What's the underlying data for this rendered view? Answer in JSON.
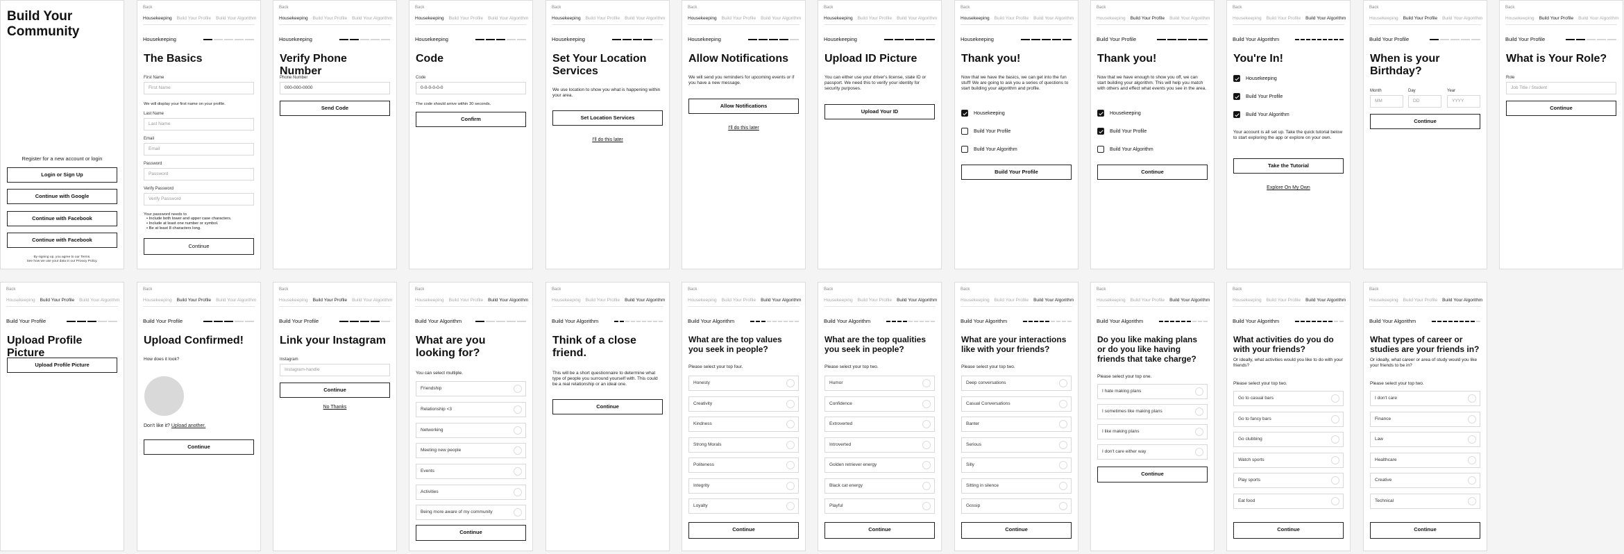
{
  "common": {
    "back": "Back",
    "tab_housekeeping": "Housekeeping",
    "tab_profile": "Build Your Profile",
    "tab_algorithm": "Build Your Algorithm",
    "continue": "Continue"
  },
  "s1": {
    "title": "Build Your Community",
    "register": "Register for a new account or login",
    "btn_login": "Login or Sign Up",
    "btn_google": "Continue with Google",
    "btn_facebook1": "Continue with Facebook",
    "btn_facebook2": "Continue with Facebook",
    "legal1": "By signing up, you agree to our Terms.",
    "legal2": "See how we use your data in our Privacy Policy."
  },
  "s2": {
    "stage": "Housekeeping",
    "title": "The Basics",
    "first_label": "First Name",
    "first_ph": "First Name",
    "first_note": "We will display your first name on your profile.",
    "last_label": "Last Name",
    "last_ph": "Last Name",
    "email_label": "Email",
    "email_ph": "Email",
    "pw_label": "Password",
    "pw_ph": "Password",
    "vpw_label": "Verify Password",
    "vpw_ph": "Verify Password",
    "pw_rules_title": "Your password needs to",
    "pw_rules": [
      "Include both lower and upper case characters.",
      "Include at least one number or symbol.",
      "Be at least 8 characters long."
    ]
  },
  "s3": {
    "stage": "Housekeeping",
    "title": "Verify Phone Number",
    "phone_label": "Phone Number",
    "phone_value": "000-000-0000",
    "btn": "Send Code"
  },
  "s4": {
    "stage": "Housekeeping",
    "title": "Code",
    "code_label": "Code",
    "code_value": "0-0-0-0-0-0",
    "note": "The code should arrive within 30 seconds.",
    "btn": "Confirm"
  },
  "s5": {
    "stage": "Housekeeping",
    "title": "Set Your Location Services",
    "note": "We use location to show you what is happening within your area.",
    "btn": "Set Location Services",
    "later": "I'll do this later"
  },
  "s6": {
    "stage": "Housekeeping",
    "title": "Allow Notifications",
    "note": "We will send you reminders for upcoming events or if you have a new message.",
    "btn": "Allow Notifications",
    "later": "I'll do this later"
  },
  "s7": {
    "stage": "Housekeeping",
    "title": "Upload ID Picture",
    "note": "You can either use your driver's license, state ID or passport. We need this to verify your identity for security purposes.",
    "btn": "Upload Your ID"
  },
  "s8": {
    "stage": "Housekeeping",
    "title": "Thank you!",
    "note": "Now that we have the basics, we can get into the fun stuff! We are going to ask you a series of questions to start building your algorithm and profile.",
    "items": [
      "Housekeeping",
      "Build Your Profile",
      "Build Your Algorithm"
    ],
    "btn": "Build Your Profile"
  },
  "s9": {
    "stage": "Build Your Profile",
    "title": "Thank you!",
    "note": "Now that we have enough to show you off, we can start building your algorithm. This will help you match with others and effect what events you see in the area.",
    "items": [
      "Housekeeping",
      "Build Your Profile",
      "Build Your Algorithm"
    ]
  },
  "s10": {
    "stage": "Build Your Algorithm",
    "title": "You're In!",
    "items": [
      "Housekeeping",
      "Build Your Profile",
      "Build Your Algorithm"
    ],
    "note": "Your account is all set up. Take the quick tutorial below to start exploring the app or explore on your own.",
    "btn": "Take the Tutorial",
    "explore": "Explore On My Own"
  },
  "s11": {
    "stage": "Build Your Profile",
    "title": "When is your Birthday?",
    "month_label": "Month",
    "month_ph": "MM",
    "day_label": "Day",
    "day_ph": "DD",
    "year_label": "Year",
    "year_ph": "YYYY"
  },
  "s12": {
    "stage": "Build Your Profile",
    "title": "What is Your Role?",
    "role_label": "Role",
    "role_ph": "Job Title / Student"
  },
  "s13": {
    "stage": "Build Your Profile",
    "title": "Upload Profile Picture",
    "btn": "Upload Profile Picture"
  },
  "s14": {
    "stage": "Build Your Profile",
    "title": "Upload Confirmed!",
    "question": "How does it look?",
    "dislike": "Don't like it?",
    "upload_another": "Upload another."
  },
  "s15": {
    "stage": "Build Your Profile",
    "title": "Link your Instagram",
    "ig_label": "Instagram",
    "ig_ph": "Instagram-handle",
    "no_thanks": "No Thanks"
  },
  "s16": {
    "stage": "Build Your Algorithm",
    "title": "What are you looking for?",
    "hint": "You can select multiple.",
    "options": [
      "Friendship",
      "Relationship <3",
      "Networking",
      "Meeting new people",
      "Events",
      "Activities",
      "Being more aware of my community"
    ]
  },
  "s17": {
    "stage": "Build Your Algorithm",
    "title": "Think of a close friend.",
    "note": "This will be a short questionnaire to determine what type of people you surround yourself with. This could be a real relationship or an ideal one."
  },
  "s18": {
    "stage": "Build Your Algorithm",
    "title": "What are the top values you seek in people?",
    "hint": "Please select your top four.",
    "options": [
      "Honesty",
      "Creativity",
      "Kindness",
      "Strong Morals",
      "Politeness",
      "Integrity",
      "Loyalty"
    ]
  },
  "s19": {
    "stage": "Build Your Algorithm",
    "title": "What are the top qualities you seek in people?",
    "hint": "Please select your top two.",
    "options": [
      "Humor",
      "Confidence",
      "Extroverted",
      "Introverted",
      "Golden retriever energy",
      "Black cat energy",
      "Playful"
    ]
  },
  "s20": {
    "stage": "Build Your Algorithm",
    "title": "What are your interactions like with your friends?",
    "hint": "Please select your top two.",
    "options": [
      "Deep conversations",
      "Casual Conversations",
      "Banter",
      "Serious",
      "Silly",
      "Sitting in silence",
      "Gossip"
    ]
  },
  "s21": {
    "stage": "Build Your Algorithm",
    "title": "Do you like making plans or do you like having friends that take charge?",
    "hint": "Please select your top one.",
    "options": [
      "I hate making plans",
      "I sometimes like making plans",
      "I like making plans",
      "I don't care either way"
    ]
  },
  "s22": {
    "stage": "Build Your Algorithm",
    "title": "What activities do you do with your friends?",
    "sub": "Or ideally, what activities would you like to do with your friends?",
    "hint": "Please select your top two.",
    "options": [
      "Go to casual bars",
      "Go to fancy bars",
      "Go clubbing",
      "Watch sports",
      "Play sports",
      "Eat food"
    ]
  },
  "s23": {
    "stage": "Build Your Algorithm",
    "title": "What types of career or studies are your friends in?",
    "sub": "Or ideally, what career or area of study would you like your friends to be in?",
    "hint": "Please select your top two.",
    "options": [
      "I don't care",
      "Finance",
      "Law",
      "Healthcare",
      "Creative",
      "Technical"
    ]
  }
}
